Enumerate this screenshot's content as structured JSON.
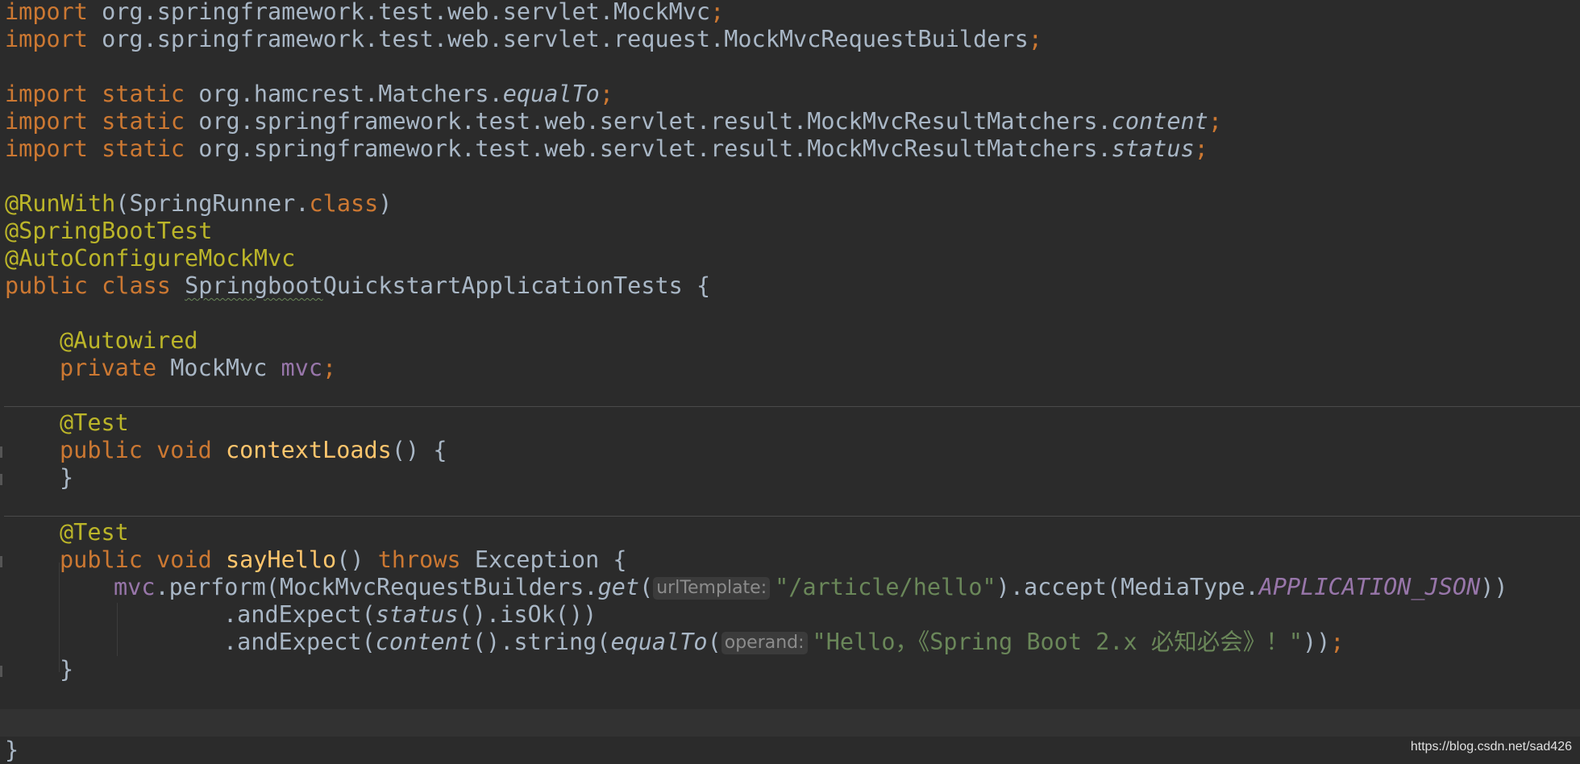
{
  "code": {
    "l1": {
      "kw": "import",
      "text": " org.springframework.test.web.servlet.MockMvc",
      "semi": ";"
    },
    "l2": {
      "kw": "import",
      "text": " org.springframework.test.web.servlet.request.MockMvcRequestBuilders",
      "semi": ";"
    },
    "l4": {
      "kw1": "import",
      "kw2": "static",
      "text": " org.hamcrest.Matchers.",
      "method": "equalTo",
      "semi": ";"
    },
    "l5": {
      "kw1": "import",
      "kw2": "static",
      "text": " org.springframework.test.web.servlet.result.MockMvcResultMatchers.",
      "method": "content",
      "semi": ";"
    },
    "l6": {
      "kw1": "import",
      "kw2": "static",
      "text": " org.springframework.test.web.servlet.result.MockMvcResultMatchers.",
      "method": "status",
      "semi": ";"
    },
    "l8": {
      "ann": "@RunWith",
      "open": "(SpringRunner.",
      "kw": "class",
      "close": ")"
    },
    "l9": {
      "ann": "@SpringBootTest"
    },
    "l10": {
      "ann": "@AutoConfigureMockMvc"
    },
    "l11": {
      "kw1": "public",
      "kw2": "class",
      "name_a": "Springboot",
      "name_b": "QuickstartApplicationTests",
      "brace": " {"
    },
    "l13": {
      "ann": "@Autowired"
    },
    "l14": {
      "kw": "private",
      "type": " MockMvc ",
      "field": "mvc",
      "semi": ";"
    },
    "l16": {
      "ann": "@Test"
    },
    "l17": {
      "kw1": "public",
      "kw2": "void",
      "fn": "contextLoads",
      "rest": "() {"
    },
    "l18": {
      "text": "}"
    },
    "l20": {
      "ann": "@Test"
    },
    "l21": {
      "kw1": "public",
      "kw2": "void",
      "fn": "sayHello",
      "mid": "() ",
      "kw3": "throws",
      "rest": " Exception {"
    },
    "l22": {
      "field": "mvc",
      "a": ".perform(MockMvcRequestBuilders.",
      "get": "get",
      "b": "(",
      "hint": "urlTemplate:",
      "str": "\"/article/hello\"",
      "c": ").accept(MediaType.",
      "const": "APPLICATION_JSON",
      "d": "))"
    },
    "l23": {
      "a": ".andExpect(",
      "status": "status",
      "b": "().isOk())"
    },
    "l24": {
      "a": ".andExpect(",
      "content": "content",
      "b": "().string(",
      "eq": "equalTo",
      "c": "(",
      "hint": "operand:",
      "str": "\"Hello，《Spring Boot 2.x 必知必会》！\"",
      "d": "))",
      "semi": ";"
    },
    "l25": {
      "text": "}"
    },
    "l28": {
      "text": "}"
    }
  },
  "watermark": "https://blog.csdn.net/sad426"
}
